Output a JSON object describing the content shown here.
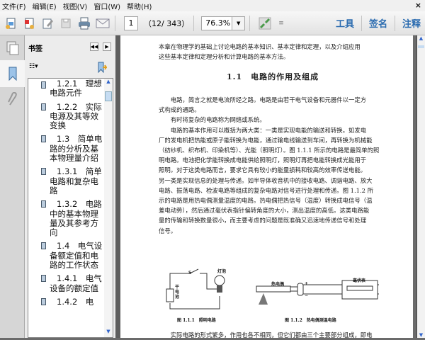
{
  "menu": [
    "文件(F)",
    "编辑(E)",
    "视图(V)",
    "窗口(W)",
    "帮助(H)"
  ],
  "close_label": "×",
  "toolbar": {
    "page": "1",
    "page_count": "（12/ 343）",
    "zoom": "76.3%",
    "tools": "工具",
    "sign": "签名",
    "comment": "注释"
  },
  "bookmarks": {
    "title": "书签",
    "items": [
      "1.2.1　理想电路元件",
      "1.2.2　实际电源及其等效变换",
      "1.3　简单电路的分析及基本物理量介绍",
      "1.3.1　简单电路和复杂电路",
      "1.3.2　电路中的基本物理量及其参考方向",
      "1.4　电气设备额定值和电路的工作状态",
      "1.4.1　电气设备的额定值",
      "1.4.2　电"
    ]
  },
  "doc": {
    "intro": [
      "本章在物理学的基础上讨论电路的基本知识、基本定律和定理，以及介绍应用",
      "这些基本定律和定理分析和计算电路的基本方法。"
    ],
    "heading": "1.1　电路的作用及组成",
    "body": [
      "　　电路，简言之就是电流所经之路。电路是由若干电气设备和元器件以一定方",
      "式构成的通路。",
      "　　有时将复杂的电路称为网络或系统。",
      "　　电路的基本作用可以概括为两大类：一类是实现电能的输送和转换。如发电",
      "厂的发电机把热能或原子能转换为电能，通过输电线输送到车间，再转换为机械能",
      "（纺纱机、织布机、印染机等）、光能（照明灯）。图 1.1.1 所示的电路是最简单的照",
      "明电路。电池把化学能转换成电能供给照明灯，照明灯再把电能转换成光能用于",
      "照明。对于这类电路而言，要求它具有较小的能量损耗和较高的效率传送电能。",
      "另一类是实现信息的处理与传递。如半导体收音机中的接收电路、调谐电路、放大",
      "电路、振荡电路、检波电路等组成的复杂电路对信号进行处理和传递。图 1.1.2 所",
      "示的电路是用热电偶测量温度的电路。热电偶把热信号（温度）转换成电信号（温",
      "差电动势），然后通过毫伏表指针偏转角度的大小，测出温度的高低。这类电路能",
      "量的传输和转换数量很小，而主要考虑的问题是既准确又迅速地传递信号和处理",
      "信号。"
    ],
    "fig1": {
      "s": "S",
      "lamp": "灯泡",
      "battery": "干电池",
      "caption": "图 1.1.1　照明电路"
    },
    "fig2": {
      "thermo": "热电偶",
      "meter": "毫伏表",
      "plus": "+",
      "minus": "−",
      "caption": "图 1.1.2　热电偶测温电路"
    },
    "last": "　　实际电路的形式繁多，作用也各不相同，但它们都由三个主要部分组成，即电"
  }
}
